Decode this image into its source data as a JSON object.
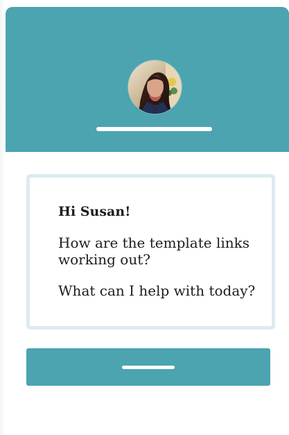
{
  "header": {
    "color": "#4ba4b0",
    "avatar": {
      "alt": "Profile photo"
    }
  },
  "message": {
    "greeting": "Hi Susan!",
    "line_1": "How are the template links\nworking out?",
    "line_2": "What can I help with today?",
    "border_color": "#dcebf0"
  },
  "button": {
    "color": "#4ba4b0"
  }
}
